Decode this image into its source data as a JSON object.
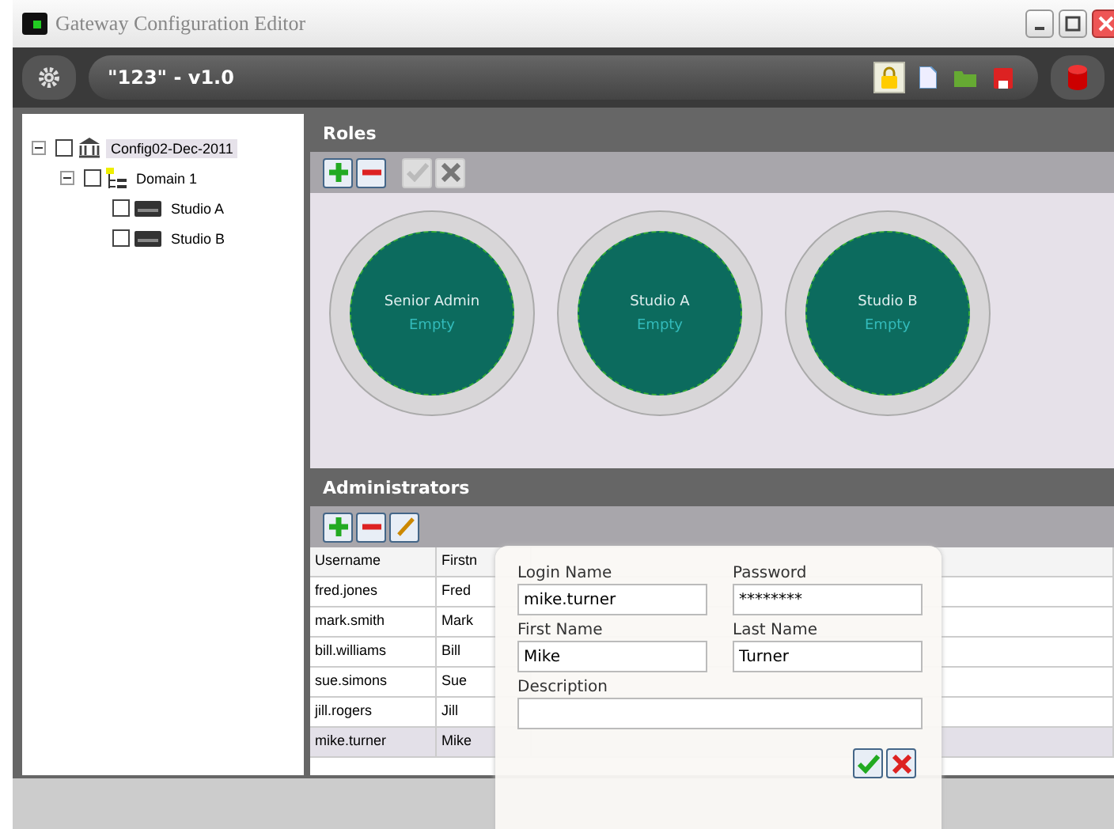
{
  "window": {
    "title": "Gateway Configuration Editor"
  },
  "toolbar": {
    "config_name": "\"123\" - v1.0",
    "lock_active": true
  },
  "tree": [
    {
      "label": "Config02-Dec-2011",
      "kind": "config",
      "checked": false,
      "expanded": true,
      "selected": true,
      "children": [
        {
          "label": "Domain 1",
          "kind": "domain",
          "checked": false,
          "expanded": true,
          "selected": false,
          "children": [
            {
              "label": "Studio A",
              "kind": "studio",
              "checked": false,
              "selected": false
            },
            {
              "label": "Studio B",
              "kind": "studio",
              "checked": false,
              "selected": false
            }
          ]
        }
      ]
    }
  ],
  "roles": {
    "title": "Roles",
    "accept_disabled": true,
    "items": [
      {
        "name": "Senior Admin",
        "status": "Empty"
      },
      {
        "name": "Studio A",
        "status": "Empty"
      },
      {
        "name": "Studio B",
        "status": "Empty"
      }
    ]
  },
  "administrators": {
    "title": "Administrators",
    "columns": [
      "Username",
      "Firstn"
    ],
    "rows": [
      {
        "cells": [
          "fred.jones",
          "Fred"
        ],
        "selected": false
      },
      {
        "cells": [
          "mark.smith",
          "Mark"
        ],
        "selected": false
      },
      {
        "cells": [
          "bill.williams",
          "Bill"
        ],
        "selected": false
      },
      {
        "cells": [
          "sue.simons",
          "Sue"
        ],
        "selected": false
      },
      {
        "cells": [
          "jill.rogers",
          "Jill"
        ],
        "selected": false
      },
      {
        "cells": [
          "mike.turner",
          "Mike"
        ],
        "selected": true
      }
    ]
  },
  "dialog": {
    "fields": [
      {
        "label": "Login Name",
        "value": "mike.turner",
        "kind": "text"
      },
      {
        "label": "Password",
        "value": "********",
        "kind": "text"
      },
      {
        "label": "First Name",
        "value": "Mike",
        "kind": "text"
      },
      {
        "label": "Last Name",
        "value": "Turner",
        "kind": "text"
      },
      {
        "label": "Description",
        "kind": "wide"
      }
    ]
  }
}
